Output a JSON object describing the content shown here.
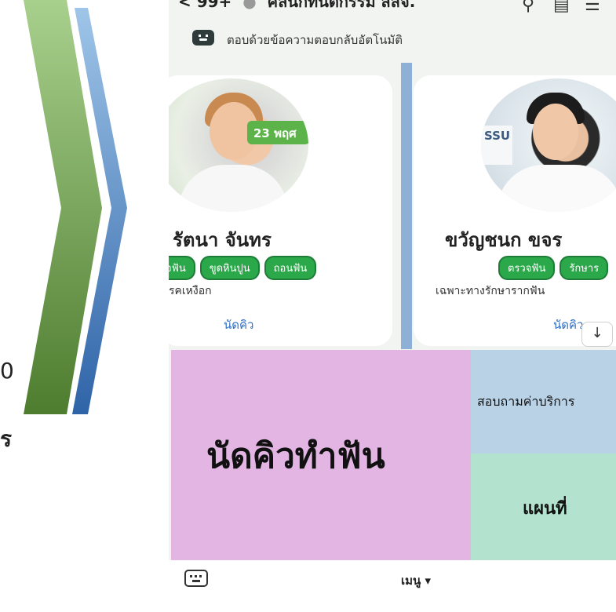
{
  "slide": {
    "left_text_1": "0",
    "left_text_2": "ร",
    "colors": {
      "green_chevron": "#6aa84f",
      "blue_chevron": "#3d85c6"
    }
  },
  "line_app": {
    "header": {
      "unread_count": "< 99+",
      "chat_title": "คลินิกทันตกรรม สสจ.",
      "icons": [
        "search-icon",
        "notes-icon",
        "menu-icon"
      ]
    },
    "auto_reply_label": "ตอบด้วยข้อความตอบกลับอัตโนมัติ",
    "cards": [
      {
        "name": "รัตนา จันทร",
        "chips": [
          "จฟัน",
          "ขูดหินปูน",
          "ถอนฟัน"
        ],
        "specialty": "รคเหงือก",
        "book_label": "นัดคิว",
        "photo_text": "23 พฤศ"
      },
      {
        "name": "ขวัญชนก ขจร",
        "chips": [
          "ตรวจฟัน",
          "รักษาร"
        ],
        "specialty": "เฉพาะทางรักษารากฟัน",
        "book_label": "นัดคิว",
        "photo_text": "SSU"
      }
    ],
    "rich_menu": {
      "book_label": "นัดคิวทำฟัน",
      "price_label": "สอบถามค่าบริการ",
      "map_label": "แผนที่",
      "colors": {
        "book_bg": "#e2b5e2",
        "price_bg": "#b9d2e6",
        "map_bg": "#b3e3cf"
      }
    },
    "bottom_bar": {
      "menu_label": "เมนู ▾"
    }
  }
}
